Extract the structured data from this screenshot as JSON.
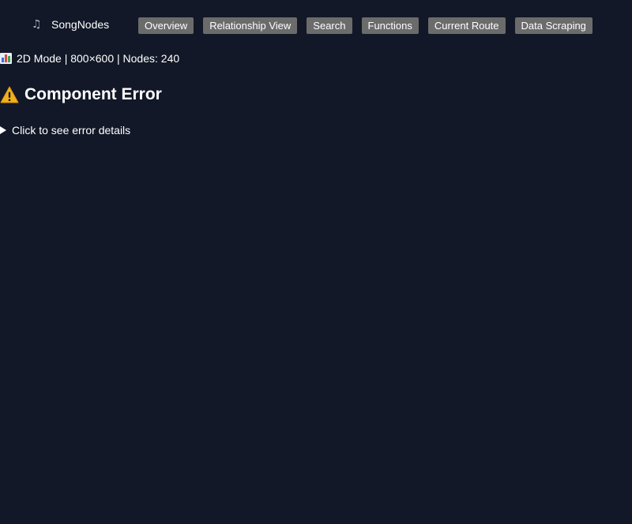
{
  "header": {
    "brand_icon": "music-note-icon",
    "brand_name": "SongNodes",
    "nav": [
      {
        "label": "Overview"
      },
      {
        "label": "Relationship View"
      },
      {
        "label": "Search"
      },
      {
        "label": "Functions"
      },
      {
        "label": "Current Route"
      },
      {
        "label": "Data Scraping"
      }
    ]
  },
  "status": {
    "icon": "bar-chart-icon",
    "text": "2D Mode | 800×600 | Nodes: 240"
  },
  "error": {
    "icon": "warning-icon",
    "title": "Component Error",
    "details_label": "Click to see error details"
  },
  "colors": {
    "background": "#121827",
    "button_bg": "#6b6b6b",
    "text": "#ffffff",
    "warning": "#f2b01e"
  }
}
